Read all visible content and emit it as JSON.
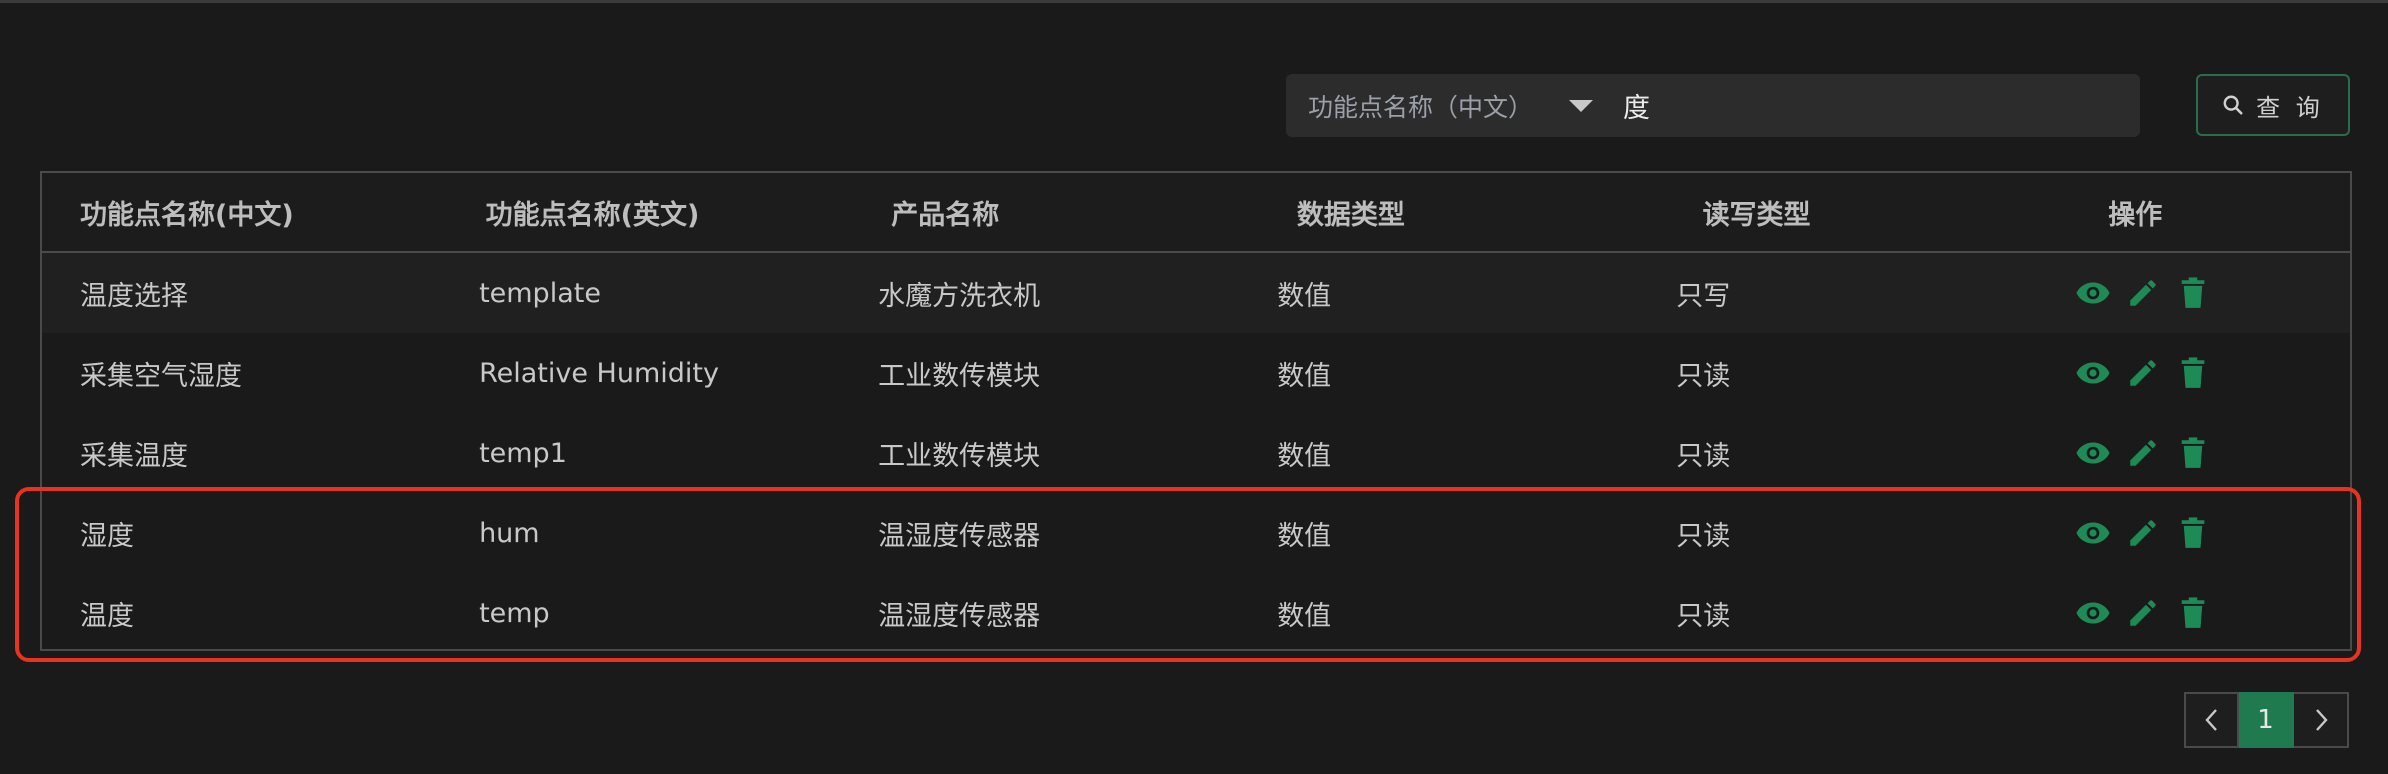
{
  "search": {
    "field_label": "功能点名称（中文）",
    "value": "度",
    "button_label": "查 询"
  },
  "table": {
    "columns": [
      "功能点名称(中文)",
      "功能点名称(英文)",
      "产品名称",
      "数据类型",
      "读写类型",
      "操作"
    ],
    "rows": [
      [
        "温度选择",
        "template",
        "水魔方洗衣机",
        "数值",
        "只写"
      ],
      [
        "采集空气湿度",
        "Relative Humidity",
        "工业数传模块",
        "数值",
        "只读"
      ],
      [
        "采集温度",
        "temp1",
        "工业数传模块",
        "数值",
        "只读"
      ],
      [
        "湿度",
        "hum",
        "温湿度传感器",
        "数值",
        "只读"
      ],
      [
        "温度",
        "temp",
        "温湿度传感器",
        "数值",
        "只读"
      ]
    ],
    "action_icons": [
      "eye-icon",
      "pencil-icon",
      "trash-icon"
    ]
  },
  "pagination": {
    "current_page": "1"
  },
  "colors": {
    "accent_green": "#1f7a4f",
    "icon_green": "#1e8a55",
    "highlight_red": "#e8331e"
  }
}
